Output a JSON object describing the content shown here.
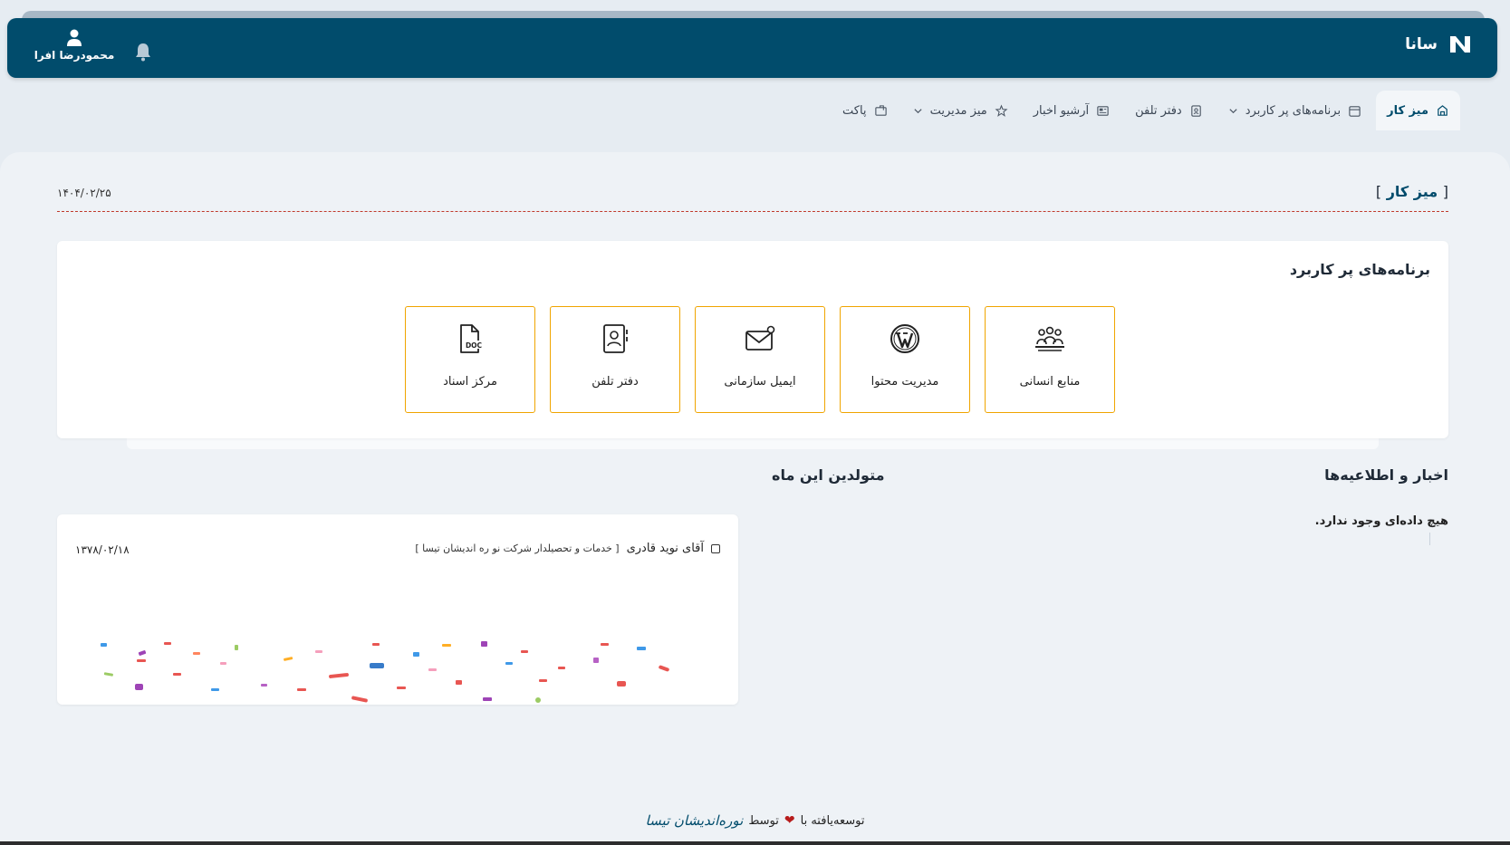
{
  "header": {
    "brand_name": "سانا",
    "user_name": "محمودرضا افرا",
    "icons": {
      "brand": "logo-icon",
      "notifications": "bell-icon",
      "user": "user-icon"
    }
  },
  "nav": {
    "items": [
      {
        "label": "میز کار",
        "icon": "desk-icon",
        "active": true
      },
      {
        "label": "برنامه‌های پر کاربرد",
        "icon": "calendar-icon",
        "dropdown": true
      },
      {
        "label": "دفتر تلفن",
        "icon": "contacts-icon"
      },
      {
        "label": "آرشیو اخبار",
        "icon": "newspaper-icon"
      },
      {
        "label": "میز مدیریت",
        "icon": "star-icon",
        "dropdown": true
      },
      {
        "label": "پاکت",
        "icon": "envelope-icon"
      }
    ]
  },
  "page": {
    "title": "میز کار",
    "bracket_open": "[",
    "bracket_close": "]",
    "date": "۱۴۰۴/۰۲/۲۵"
  },
  "apps": {
    "title": "برنامه‌های پر کاربرد",
    "items": [
      {
        "label": "مرکز اسناد",
        "icon": "document-icon"
      },
      {
        "label": "دفتر تلفن",
        "icon": "phonebook-icon"
      },
      {
        "label": "ایمیل سازمانی",
        "icon": "email-icon"
      },
      {
        "label": "مدیریت محتوا",
        "icon": "wordpress-icon"
      },
      {
        "label": "منابع انسانی",
        "icon": "people-icon"
      }
    ]
  },
  "news": {
    "title": "اخبار و اطلاعیه‌ها",
    "empty_text": "هیچ داده‌ای وجود ندارد."
  },
  "birthdays": {
    "title": "متولدین این ماه",
    "items": [
      {
        "name": "آقای نوید قادری",
        "desc": "[ خدمات و تحصیلدار شرکت نو ره اندیشان تیسا ]",
        "date": "۱۳۷۸/۰۲/۱۸"
      }
    ]
  },
  "footer": {
    "prefix": "توسعه‌یافته با",
    "by": "توسط",
    "company": "نوره‌اندیشان تیسا"
  },
  "colors": {
    "header_bg": "#014c6c",
    "tile_border": "#f0a500",
    "divider": "#c0392b",
    "heart": "#b71c1c"
  }
}
